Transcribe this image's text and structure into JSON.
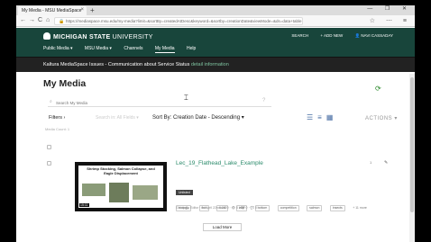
{
  "browser": {
    "tab_title": "My Media - MSU MediaSpace",
    "tab_close": "×",
    "new_tab": "+",
    "window_controls": "— ❐ ✕",
    "url": "https://mediaspace.msu.edu/my-media?limit=&sortBy=createdAtDesc&keyword=&sortby=creationDate&viewMode=&ds=data+table",
    "back": "←",
    "forward": "→",
    "reload": "C",
    "home": "⌂",
    "lock": "🔒",
    "toolbar_icons": "☆ ⋯ ≡"
  },
  "header": {
    "logo_bold": "MICHIGAN STATE",
    "logo_light": " UNIVERSITY",
    "search": "SEARCH",
    "add_new": "+ ADD NEW",
    "user": "👤 NAVI CASSADAY",
    "nav": [
      "Public Media ▾",
      "MSU Media ▾",
      "Channels",
      "My Media",
      "Help"
    ]
  },
  "notice": {
    "text": "Kaltura MediaSpace Issues - Communication about Service Status",
    "link": "detail information"
  },
  "page": {
    "title": "My Media",
    "search_placeholder": "Search My Media",
    "search_help": "?",
    "filters": "Filters ›",
    "filter_hidden": "Search in: All Fields ▾",
    "sort": "Sort By: Creation Date - Descending ▾",
    "actions": "ACTIONS ▾",
    "media_count": "Media Count: 1",
    "load_more": "Load More"
  },
  "media_item": {
    "title": "Lec_19_Flathead_Lake_Example",
    "thumb_title": "Shrimp Stocking, Salmon Collapse, and Eagle Displacement",
    "duration": "15:11",
    "status": "Unlisted",
    "stats": "1",
    "tags": [
      "biology",
      "fish",
      "food",
      "lake",
      "bottom",
      "competition",
      "salmon",
      "insects"
    ],
    "more_tags": "+ 11 more",
    "meta": "Group Co Editor  ·  on April 22nd, 2020  ·  👁 0  ·  ❤ 0  ·  💬 0"
  }
}
